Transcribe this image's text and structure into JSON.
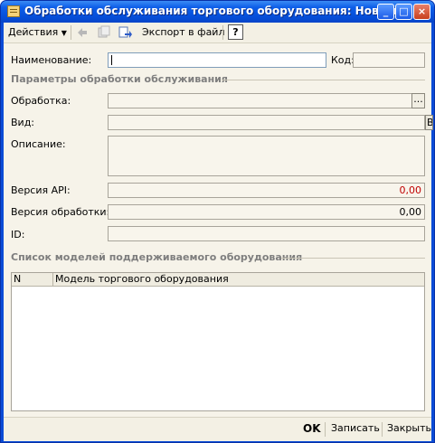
{
  "window": {
    "title": "Обработки обслуживания торгового оборудования: Новый",
    "controls": {
      "minimize": "_",
      "maximize": "□",
      "close": "×"
    }
  },
  "toolbar": {
    "actions_label": "Действия",
    "export_label": "Экспорт в файл",
    "help_label": "?"
  },
  "form": {
    "name_label": "Наименование:",
    "name_value": "",
    "code_label": "Код:",
    "code_value": "",
    "section_params": "Параметры обработки обслуживания",
    "processing_label": "Обработка:",
    "processing_value": "",
    "processing_select": "...",
    "kind_label": "Вид:",
    "kind_value": "",
    "kind_cut_text": "Вы",
    "description_label": "Описание:",
    "description_value": "",
    "api_version_label": "Версия API:",
    "api_version_value": "0,00",
    "processing_version_label": "Версия обработки:",
    "processing_version_value": "0,00",
    "id_label": "ID:",
    "id_value": "",
    "section_models": "Список моделей поддерживаемого оборудования"
  },
  "table": {
    "columns": [
      "N",
      "Модель торгового оборудования"
    ],
    "rows": []
  },
  "footer": {
    "ok_label": "OK",
    "save_label": "Записать",
    "close_label": "Закрыть"
  },
  "colors": {
    "title_bar": "#0a4bd6",
    "form_bg": "#f6f3e9",
    "api_value": "#c00000"
  }
}
